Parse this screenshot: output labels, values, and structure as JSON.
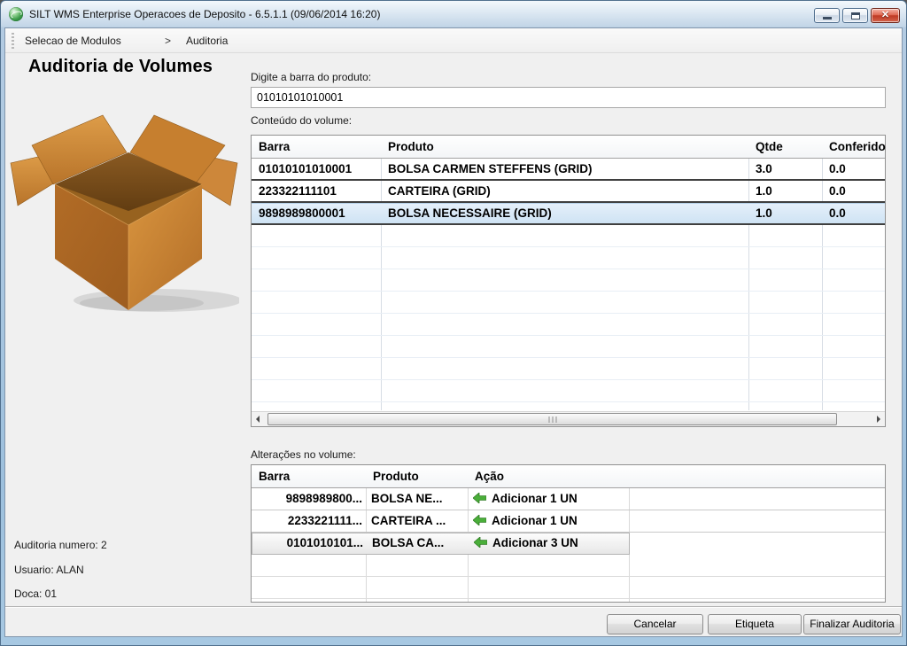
{
  "window": {
    "title": "SILT WMS Enterprise Operacoes de Deposito - 6.5.1.1 (09/06/2014 16:20)"
  },
  "breadcrumb": {
    "module": "Selecao de Modulos",
    "separator": ">",
    "section": "Auditoria"
  },
  "page": {
    "title": "Auditoria de Volumes"
  },
  "scan": {
    "label": "Digite a barra do produto:",
    "value": "01010101010001"
  },
  "content_table": {
    "label": "Conteúdo do volume:",
    "columns": {
      "barra": "Barra",
      "produto": "Produto",
      "qtde": "Qtde",
      "conferido": "Conferido"
    },
    "rows": [
      {
        "barra": "01010101010001",
        "produto": "BOLSA CARMEN STEFFENS (GRID)",
        "qtde": "3.0",
        "conferido": "0.0",
        "selected": false
      },
      {
        "barra": "223322111101",
        "produto": "CARTEIRA (GRID)",
        "qtde": "1.0",
        "conferido": "0.0",
        "selected": false
      },
      {
        "barra": "9898989800001",
        "produto": "BOLSA NECESSAIRE (GRID)",
        "qtde": "1.0",
        "conferido": "0.0",
        "selected": true
      }
    ]
  },
  "changes_table": {
    "label": "Alterações no volume:",
    "columns": {
      "barra": "Barra",
      "produto": "Produto",
      "acao": "Ação"
    },
    "rows": [
      {
        "barra": "9898989800...",
        "produto": "BOLSA NE...",
        "acao": "Adicionar 1 UN",
        "selected": false
      },
      {
        "barra": "2233221111...",
        "produto": "CARTEIRA ...",
        "acao": "Adicionar 1 UN",
        "selected": false
      },
      {
        "barra": "0101010101...",
        "produto": "BOLSA CA...",
        "acao": "Adicionar 3 UN",
        "selected": true
      }
    ]
  },
  "status": {
    "auditoria": "Auditoria numero: 2",
    "usuario": "Usuario: ALAN",
    "doca": "Doca: 01"
  },
  "footer": {
    "cancel": "Cancelar",
    "etiqueta": "Etiqueta",
    "finalizar": "Finalizar Auditoria"
  },
  "icons": {
    "app": "green-globe",
    "action_add": "green-left-arrow",
    "scroll_left": "left-triangle",
    "scroll_right": "right-triangle"
  },
  "colors": {
    "selection_blue": "#d8e7f6",
    "selection_gray": "#ececec",
    "action_green": "#3fa433",
    "close_red": "#c5392a",
    "titlebar_blue": "#c9daeb",
    "box_orange": "#c57e2e"
  }
}
